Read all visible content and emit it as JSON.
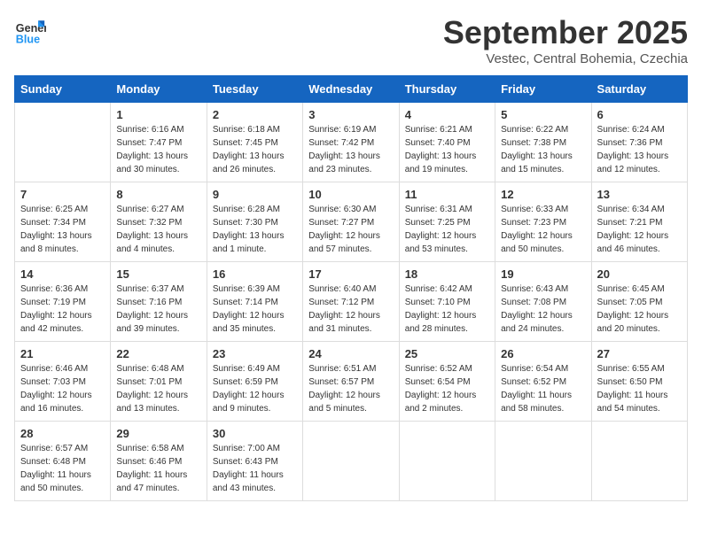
{
  "header": {
    "logo_general": "General",
    "logo_blue": "Blue",
    "month_title": "September 2025",
    "location": "Vestec, Central Bohemia, Czechia"
  },
  "days_of_week": [
    "Sunday",
    "Monday",
    "Tuesday",
    "Wednesday",
    "Thursday",
    "Friday",
    "Saturday"
  ],
  "weeks": [
    [
      {
        "day": "",
        "info": ""
      },
      {
        "day": "1",
        "info": "Sunrise: 6:16 AM\nSunset: 7:47 PM\nDaylight: 13 hours\nand 30 minutes."
      },
      {
        "day": "2",
        "info": "Sunrise: 6:18 AM\nSunset: 7:45 PM\nDaylight: 13 hours\nand 26 minutes."
      },
      {
        "day": "3",
        "info": "Sunrise: 6:19 AM\nSunset: 7:42 PM\nDaylight: 13 hours\nand 23 minutes."
      },
      {
        "day": "4",
        "info": "Sunrise: 6:21 AM\nSunset: 7:40 PM\nDaylight: 13 hours\nand 19 minutes."
      },
      {
        "day": "5",
        "info": "Sunrise: 6:22 AM\nSunset: 7:38 PM\nDaylight: 13 hours\nand 15 minutes."
      },
      {
        "day": "6",
        "info": "Sunrise: 6:24 AM\nSunset: 7:36 PM\nDaylight: 13 hours\nand 12 minutes."
      }
    ],
    [
      {
        "day": "7",
        "info": "Sunrise: 6:25 AM\nSunset: 7:34 PM\nDaylight: 13 hours\nand 8 minutes."
      },
      {
        "day": "8",
        "info": "Sunrise: 6:27 AM\nSunset: 7:32 PM\nDaylight: 13 hours\nand 4 minutes."
      },
      {
        "day": "9",
        "info": "Sunrise: 6:28 AM\nSunset: 7:30 PM\nDaylight: 13 hours\nand 1 minute."
      },
      {
        "day": "10",
        "info": "Sunrise: 6:30 AM\nSunset: 7:27 PM\nDaylight: 12 hours\nand 57 minutes."
      },
      {
        "day": "11",
        "info": "Sunrise: 6:31 AM\nSunset: 7:25 PM\nDaylight: 12 hours\nand 53 minutes."
      },
      {
        "day": "12",
        "info": "Sunrise: 6:33 AM\nSunset: 7:23 PM\nDaylight: 12 hours\nand 50 minutes."
      },
      {
        "day": "13",
        "info": "Sunrise: 6:34 AM\nSunset: 7:21 PM\nDaylight: 12 hours\nand 46 minutes."
      }
    ],
    [
      {
        "day": "14",
        "info": "Sunrise: 6:36 AM\nSunset: 7:19 PM\nDaylight: 12 hours\nand 42 minutes."
      },
      {
        "day": "15",
        "info": "Sunrise: 6:37 AM\nSunset: 7:16 PM\nDaylight: 12 hours\nand 39 minutes."
      },
      {
        "day": "16",
        "info": "Sunrise: 6:39 AM\nSunset: 7:14 PM\nDaylight: 12 hours\nand 35 minutes."
      },
      {
        "day": "17",
        "info": "Sunrise: 6:40 AM\nSunset: 7:12 PM\nDaylight: 12 hours\nand 31 minutes."
      },
      {
        "day": "18",
        "info": "Sunrise: 6:42 AM\nSunset: 7:10 PM\nDaylight: 12 hours\nand 28 minutes."
      },
      {
        "day": "19",
        "info": "Sunrise: 6:43 AM\nSunset: 7:08 PM\nDaylight: 12 hours\nand 24 minutes."
      },
      {
        "day": "20",
        "info": "Sunrise: 6:45 AM\nSunset: 7:05 PM\nDaylight: 12 hours\nand 20 minutes."
      }
    ],
    [
      {
        "day": "21",
        "info": "Sunrise: 6:46 AM\nSunset: 7:03 PM\nDaylight: 12 hours\nand 16 minutes."
      },
      {
        "day": "22",
        "info": "Sunrise: 6:48 AM\nSunset: 7:01 PM\nDaylight: 12 hours\nand 13 minutes."
      },
      {
        "day": "23",
        "info": "Sunrise: 6:49 AM\nSunset: 6:59 PM\nDaylight: 12 hours\nand 9 minutes."
      },
      {
        "day": "24",
        "info": "Sunrise: 6:51 AM\nSunset: 6:57 PM\nDaylight: 12 hours\nand 5 minutes."
      },
      {
        "day": "25",
        "info": "Sunrise: 6:52 AM\nSunset: 6:54 PM\nDaylight: 12 hours\nand 2 minutes."
      },
      {
        "day": "26",
        "info": "Sunrise: 6:54 AM\nSunset: 6:52 PM\nDaylight: 11 hours\nand 58 minutes."
      },
      {
        "day": "27",
        "info": "Sunrise: 6:55 AM\nSunset: 6:50 PM\nDaylight: 11 hours\nand 54 minutes."
      }
    ],
    [
      {
        "day": "28",
        "info": "Sunrise: 6:57 AM\nSunset: 6:48 PM\nDaylight: 11 hours\nand 50 minutes."
      },
      {
        "day": "29",
        "info": "Sunrise: 6:58 AM\nSunset: 6:46 PM\nDaylight: 11 hours\nand 47 minutes."
      },
      {
        "day": "30",
        "info": "Sunrise: 7:00 AM\nSunset: 6:43 PM\nDaylight: 11 hours\nand 43 minutes."
      },
      {
        "day": "",
        "info": ""
      },
      {
        "day": "",
        "info": ""
      },
      {
        "day": "",
        "info": ""
      },
      {
        "day": "",
        "info": ""
      }
    ]
  ]
}
